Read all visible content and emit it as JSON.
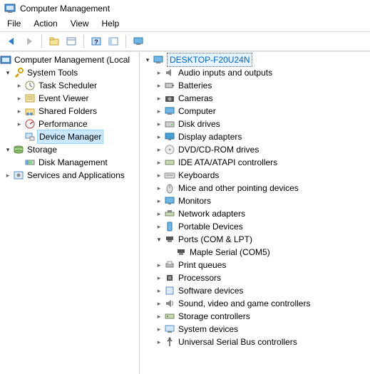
{
  "window": {
    "title": "Computer Management"
  },
  "menu": {
    "file": "File",
    "action": "Action",
    "view": "View",
    "help": "Help"
  },
  "left_tree": {
    "root": "Computer Management (Local",
    "system_tools": "System Tools",
    "task_scheduler": "Task Scheduler",
    "event_viewer": "Event Viewer",
    "shared_folders": "Shared Folders",
    "performance": "Performance",
    "device_manager": "Device Manager",
    "storage": "Storage",
    "disk_management": "Disk Management",
    "services_apps": "Services and Applications"
  },
  "right_tree": {
    "root": "DESKTOP-F20U24N",
    "audio": "Audio inputs and outputs",
    "batteries": "Batteries",
    "cameras": "Cameras",
    "computer": "Computer",
    "disk_drives": "Disk drives",
    "display_adapters": "Display adapters",
    "dvd": "DVD/CD-ROM drives",
    "ide": "IDE ATA/ATAPI controllers",
    "keyboards": "Keyboards",
    "mice": "Mice and other pointing devices",
    "monitors": "Monitors",
    "network": "Network adapters",
    "portable": "Portable Devices",
    "ports": "Ports (COM & LPT)",
    "maple_serial": "Maple Serial (COM5)",
    "print_queues": "Print queues",
    "processors": "Processors",
    "software_devices": "Software devices",
    "sound": "Sound, video and game controllers",
    "storage_ctrl": "Storage controllers",
    "system_devices": "System devices",
    "usb": "Universal Serial Bus controllers"
  }
}
